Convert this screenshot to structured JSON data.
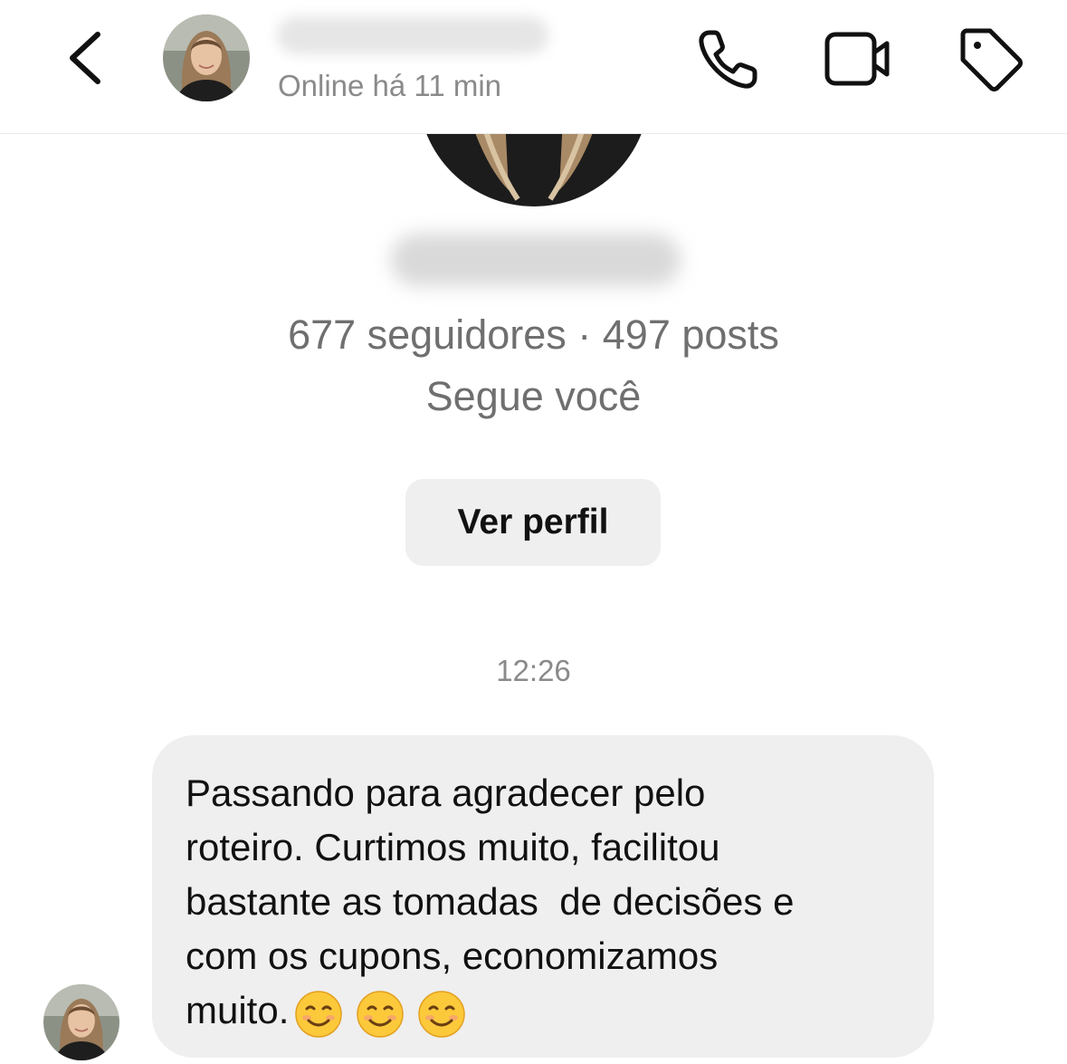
{
  "header": {
    "back_icon": "chevron-left-icon",
    "contact_status": "Online há 11 min",
    "call_icon": "phone-icon",
    "video_icon": "video-camera-icon",
    "tag_icon": "tag-icon"
  },
  "profile": {
    "stats": "677 seguidores · 497 posts",
    "follows_you": "Segue você",
    "view_profile_label": "Ver perfil"
  },
  "conversation": {
    "timestamp": "12:26",
    "message": {
      "text": "Passando para agradecer pelo\nroteiro. Curtimos muito, facilitou\nbastante as tomadas  de decisões e\ncom os cupons, economizamos\nmuito.",
      "emoji_icon": "smiling-face-emoji-icon",
      "emoji_count": 3
    }
  },
  "colors": {
    "bubble": "#efefef",
    "secondary_text": "#8a8a8a",
    "primary_text": "#111111"
  }
}
